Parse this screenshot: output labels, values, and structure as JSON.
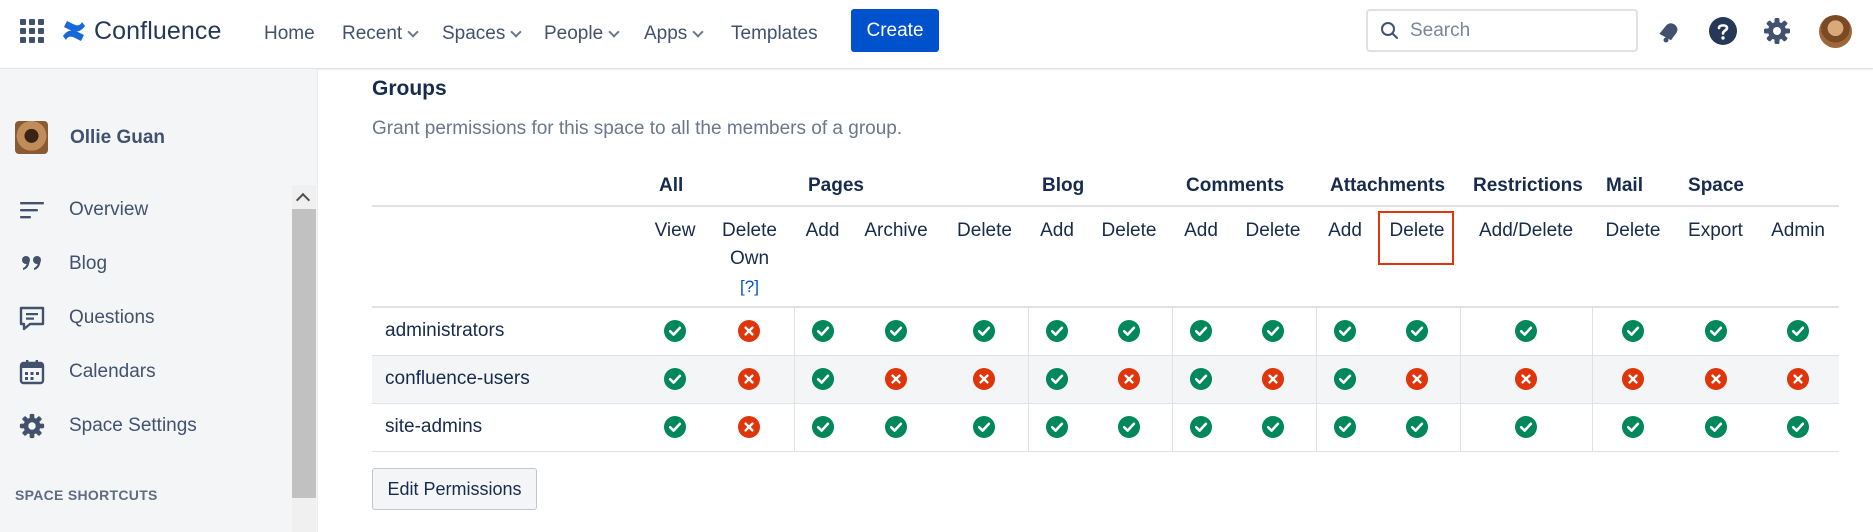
{
  "topnav": {
    "logo_text": "Confluence",
    "items": [
      {
        "label": "Home",
        "has_dropdown": false
      },
      {
        "label": "Recent",
        "has_dropdown": true
      },
      {
        "label": "Spaces",
        "has_dropdown": true
      },
      {
        "label": "People",
        "has_dropdown": true
      },
      {
        "label": "Apps",
        "has_dropdown": true
      },
      {
        "label": "Templates",
        "has_dropdown": false
      }
    ],
    "create_label": "Create",
    "search_placeholder": "Search",
    "icons": [
      "notifications-icon",
      "help-icon",
      "settings-icon",
      "profile-avatar"
    ]
  },
  "sidebar": {
    "user_name": "Ollie Guan",
    "items": [
      {
        "label": "Overview",
        "icon": "overview-icon"
      },
      {
        "label": "Blog",
        "icon": "blog-quote-icon"
      },
      {
        "label": "Questions",
        "icon": "questions-icon"
      },
      {
        "label": "Calendars",
        "icon": "calendar-icon"
      },
      {
        "label": "Space Settings",
        "icon": "gear-icon"
      }
    ],
    "shortcuts_heading": "SPACE SHORTCUTS"
  },
  "main": {
    "title": "Groups",
    "description": "Grant permissions for this space to all the members of a group.",
    "column_groups": [
      "All",
      "Pages",
      "Blog",
      "Comments",
      "Attachments",
      "Restrictions",
      "Mail",
      "Space"
    ],
    "columns": [
      {
        "label": "View"
      },
      {
        "label": "Delete Own",
        "help": "[?]"
      },
      {
        "label": "Add"
      },
      {
        "label": "Archive"
      },
      {
        "label": "Delete"
      },
      {
        "label": "Add"
      },
      {
        "label": "Delete"
      },
      {
        "label": "Add"
      },
      {
        "label": "Delete"
      },
      {
        "label": "Add"
      },
      {
        "label": "Delete",
        "highlighted": true
      },
      {
        "label": "Add/Delete"
      },
      {
        "label": "Delete"
      },
      {
        "label": "Export"
      },
      {
        "label": "Admin"
      }
    ],
    "rows": [
      {
        "group": "administrators",
        "perms": [
          true,
          false,
          true,
          true,
          true,
          true,
          true,
          true,
          true,
          true,
          true,
          true,
          true,
          true,
          true
        ]
      },
      {
        "group": "confluence-users",
        "perms": [
          true,
          false,
          true,
          false,
          false,
          true,
          false,
          true,
          false,
          true,
          false,
          false,
          false,
          false,
          false
        ]
      },
      {
        "group": "site-admins",
        "perms": [
          true,
          false,
          true,
          true,
          true,
          true,
          true,
          true,
          true,
          true,
          true,
          true,
          true,
          true,
          true
        ]
      }
    ],
    "edit_button_label": "Edit Permissions"
  },
  "colors": {
    "brand_blue": "#0052cc",
    "permission_granted": "#00875a",
    "permission_denied": "#de350b",
    "highlight_box": "#de350b"
  }
}
